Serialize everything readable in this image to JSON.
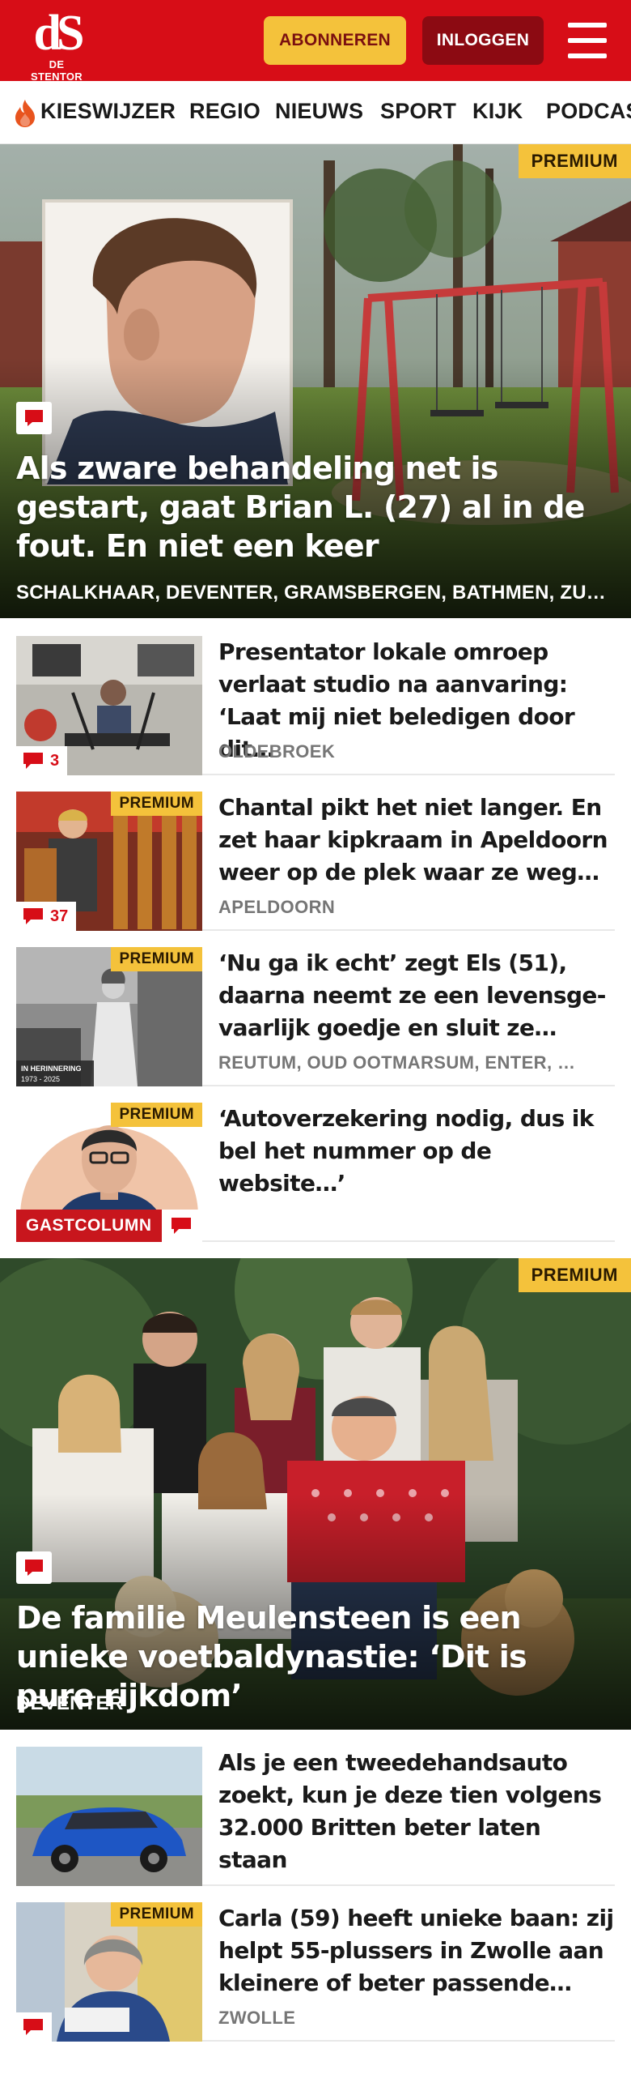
{
  "header": {
    "logo_mark": "dS",
    "logo_text": "DE STENTOR",
    "subscribe_label": "ABONNEREN",
    "login_label": "INLOGGEN",
    "menu_icon": "hamburger-menu-icon",
    "brand_color": "#d70d17"
  },
  "nav": {
    "items": [
      "KIESWIJZER",
      "REGIO",
      "NIEUWS",
      "SPORT",
      "KIJK",
      "PODCAST"
    ],
    "first_item_icon": "flame-icon"
  },
  "hero1": {
    "badge": "PREMIUM",
    "title": "Als zware behandeling net is gestart, gaat Brian L. (27) al in de fout. En niet een keer",
    "locations": "SCHALKHAAR, DEVENTER, GRAMSBERGEN, BATHMEN, ZUT…"
  },
  "list1": [
    {
      "title": "Presentator lokale omroep verlaat studio na aanvaring: ‘Laat mij niet beledigen door dit…",
      "location": "OLDEBROEK",
      "premium": false,
      "comments": "3"
    },
    {
      "title": "Chantal pikt het niet langer. En zet haar kipkraam in Apeldoorn weer op de plek waar ze weg…",
      "location": "APELDOORN",
      "premium": true,
      "badge": "PREMIUM",
      "comments": "37"
    },
    {
      "title": "‘Nu ga ik echt’ zegt Els (51), daarna neemt ze een levensge-vaarlijk goedje en sluit ze…",
      "location": "REUTUM, OUD OOTMARSUM, ENTER, …",
      "premium": true,
      "badge": "PREMIUM",
      "thumb_caption_1": "IN HERINNERING",
      "thumb_caption_2": "1973 - 2025"
    },
    {
      "title": "‘Autoverzekering nodig, dus ik bel het nummer op de website…’",
      "location": "",
      "premium": true,
      "badge": "PREMIUM",
      "tag": "GASTCOLUMN"
    }
  ],
  "hero2": {
    "badge": "PREMIUM",
    "title": "De familie Meulensteen is een unieke voetbaldynastie: ‘Dit is pure rijkdom’",
    "locations": "DEVENTER"
  },
  "list2": [
    {
      "title": "Als je een tweedehandsauto zoekt, kun je deze tien volgens 32.000 Britten beter laten staan",
      "location": "",
      "premium": false
    },
    {
      "title": "Carla (59) heeft unieke baan: zij helpt 55-plussers in Zwolle aan kleinere of beter passende…",
      "location": "ZWOLLE",
      "premium": true,
      "badge": "PREMIUM"
    }
  ]
}
